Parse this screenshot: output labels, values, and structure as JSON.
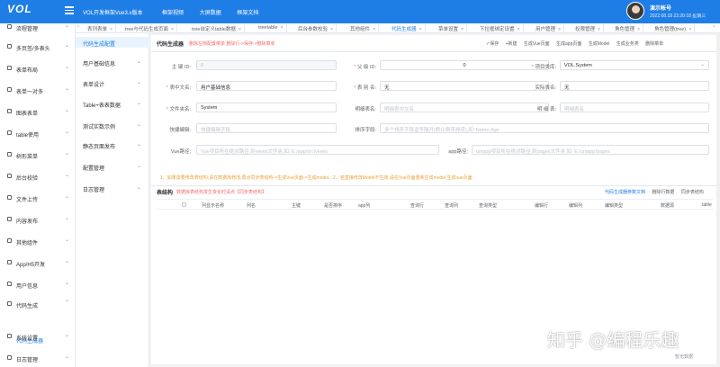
{
  "header": {
    "logo": "VOL",
    "app_title": "VOL开发框架Vue3.x版本",
    "links": [
      "框架视频",
      "大屏数据",
      "框架文档"
    ],
    "user_name": "演示帐号",
    "user_date": "2022.08.18 22:20:18 星期三"
  },
  "sidebar": {
    "items": [
      {
        "label": "流程管理"
      },
      {
        "label": "多页签/多表头"
      },
      {
        "label": "表单布局"
      },
      {
        "label": "表单一对多"
      },
      {
        "label": "图表表单"
      },
      {
        "label": "table使用"
      },
      {
        "label": "树形菜单"
      },
      {
        "label": "后台校验"
      },
      {
        "label": "文件上传"
      },
      {
        "label": "内容发布"
      },
      {
        "label": "其他组件"
      },
      {
        "label": "App/H5开发"
      },
      {
        "label": "用户信息"
      },
      {
        "label": "代码生成"
      },
      {
        "label": "系统设置"
      },
      {
        "label": "日志管理"
      }
    ],
    "active_sub": "代码生成器"
  },
  "tabs": [
    {
      "label": "表列表单"
    },
    {
      "label": "tree与代码生成页面"
    },
    {
      "label": "tree自定义table数据"
    },
    {
      "label": "treetable"
    },
    {
      "label": "后台参数校验"
    },
    {
      "label": "其他组件"
    },
    {
      "label": "代码生成器"
    },
    {
      "label": "菜单设置"
    },
    {
      "label": "下拉框绑定设置"
    },
    {
      "label": "用户管理"
    },
    {
      "label": "权限管理"
    },
    {
      "label": "角色管理"
    },
    {
      "label": "角色管理(tree)"
    }
  ],
  "subsidebar": {
    "title": "代码生成配置",
    "items": [
      {
        "label": "用户基础信息"
      },
      {
        "label": "表单设计"
      },
      {
        "label": "Table+表表数据"
      },
      {
        "label": "测试实数示例"
      },
      {
        "label": "静态页面发布"
      },
      {
        "label": "配置管理"
      },
      {
        "label": "日志管理"
      }
    ]
  },
  "panel": {
    "title": "代码生成器",
    "hint": "删除左侧配置菜单 删除行->保存->删除菜单",
    "toolbar": [
      "✓保存",
      "+新建",
      "生成Vue页面",
      "生成app页面",
      "生成Model",
      "生成业务类",
      "删除菜单"
    ]
  },
  "form": {
    "pk_label": "主 键 ID:",
    "pk_value": "8",
    "parent_label": "父 级 ID:",
    "parent_value": "0",
    "project_label": "项目类库:",
    "project_value": "VOL.System",
    "cn_label": "表中文名:",
    "cn_value": "用户基础信息",
    "table_label": "表 别 名:",
    "table_value": "无",
    "actual_label": "实际表名:",
    "actual_value": "无",
    "folder_label": "文件夹名:",
    "folder_value": "System",
    "desc_label": "明细表名:",
    "desc_placeholder": "明细表中文名",
    "detail_label": "明 细 表:",
    "detail_placeholder": "明细表名",
    "quick_label": "快捷编辑:",
    "quick_placeholder": "快捷编辑字段",
    "sort_label": "排序字段:",
    "sort_placeholder": "多个排序字段逗号隔开(默认倒序排序),如: Name,Age",
    "vue_label": "Vue路径:",
    "vue_placeholder": "Vue项目所在绝对路径,到views文件夹,如: E:/app/src/views",
    "app_label": "app路径:",
    "app_placeholder": "uniapp项目所在绝对路径,到pages文件夹,如: E:/uniapp/pages"
  },
  "tip": "1、如果需要修改表结构,请在数据库修改,再点同步表结构->生成Vue页面->生成model。2、若直接修改Model不生效,请在Vue页面重新生成model,生成vue页面",
  "table": {
    "title": "表结构",
    "hint": "数据库表结构发生变化时请点【同步表结构】",
    "links": [
      "代码生成器参数文档",
      "删除行数据",
      "同步表结构"
    ],
    "columns": [
      "列显示名称",
      "列名",
      "主键",
      "是否排序",
      "app列",
      "查询行",
      "查询列",
      "查询类型",
      "编辑行",
      "编辑列",
      "编辑类型",
      "数据源",
      "table"
    ],
    "empty": "暂无数据"
  },
  "watermark": "知乎 @编程乐趣",
  "colors": {
    "primary": "#1f7ee6",
    "danger": "#f56c6c",
    "warning": "#e6a23c"
  }
}
